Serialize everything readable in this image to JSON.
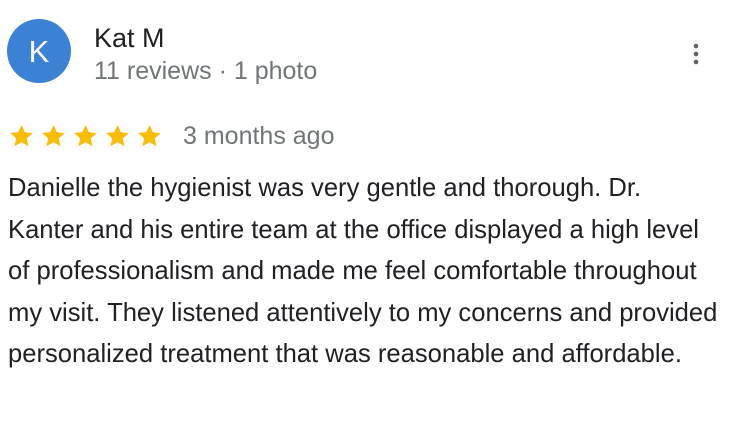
{
  "review": {
    "author": {
      "initial": "K",
      "name": "Kat M",
      "meta": "11 reviews · 1 photo",
      "avatar_color": "#3b82d4"
    },
    "more_icon": "more-vertical-icon",
    "rating": {
      "stars": 5,
      "max_stars": 5,
      "star_color": "#fbbc04",
      "star_icon": "star-icon"
    },
    "date": "3 months ago",
    "text": "Danielle the hygienist was very gentle and thorough. Dr. Kanter and his entire team at the office displayed a high level of professionalism and made me feel comfortable throughout my visit. They listened attentively to my concerns and provided personalized treatment that was reasonable and affordable."
  }
}
